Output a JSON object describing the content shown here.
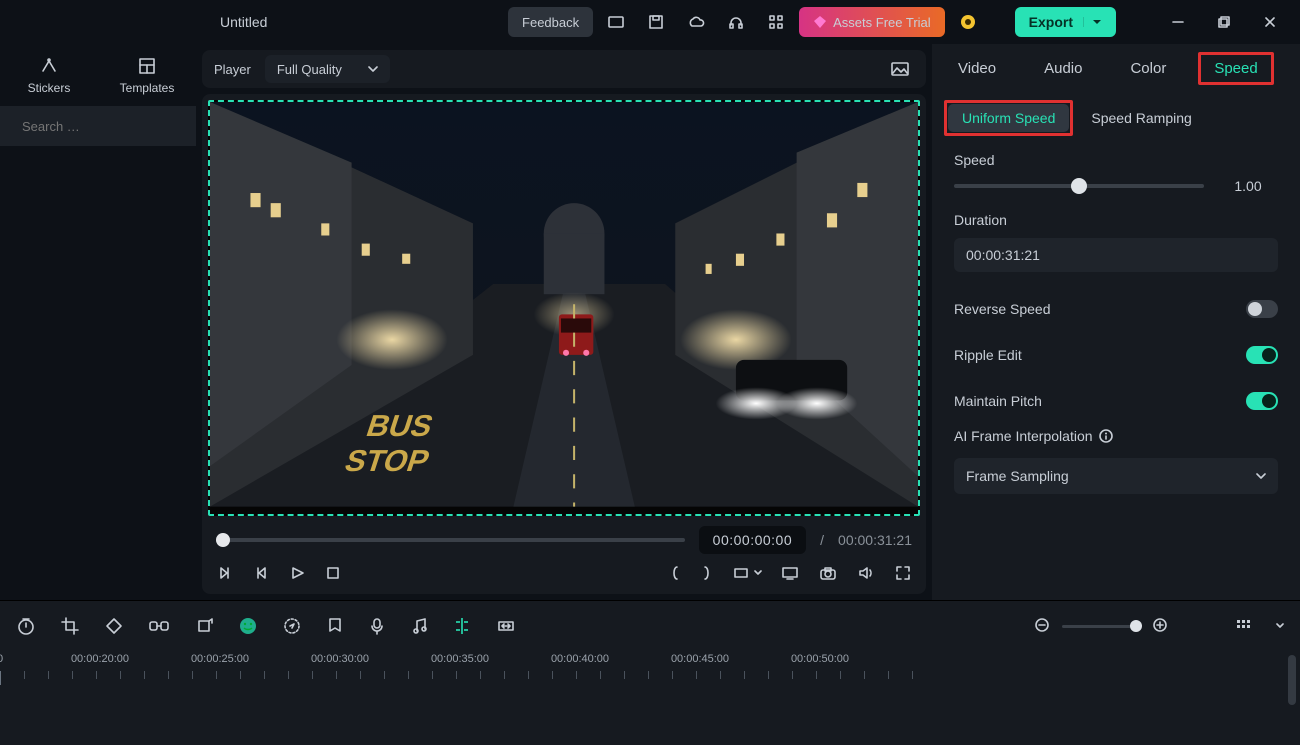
{
  "topbar": {
    "title": "Untitled",
    "feedback": "Feedback",
    "assets": "Assets Free Trial",
    "export": "Export"
  },
  "left": {
    "tabs": [
      "Stickers",
      "Templates"
    ],
    "search_placeholder": "Search …"
  },
  "player": {
    "label": "Player",
    "quality": "Full Quality",
    "current": "00:00:00:00",
    "sep": "/",
    "duration": "00:00:31:21"
  },
  "inspector": {
    "tabs": [
      "Video",
      "Audio",
      "Color",
      "Speed"
    ],
    "active_tab": 3,
    "subtabs": [
      "Uniform Speed",
      "Speed Ramping"
    ],
    "speed_label": "Speed",
    "speed_value": "1.00",
    "duration_label": "Duration",
    "duration_value": "00:00:31:21",
    "reverse": "Reverse Speed",
    "ripple": "Ripple Edit",
    "pitch": "Maintain Pitch",
    "ai": "AI Frame Interpolation",
    "ai_option": "Frame Sampling"
  },
  "timeline": {
    "labels": [
      "0",
      "00:00:20:00",
      "00:00:25:00",
      "00:00:30:00",
      "00:00:35:00",
      "00:00:40:00",
      "00:00:45:00",
      "00:00:50:00"
    ]
  }
}
